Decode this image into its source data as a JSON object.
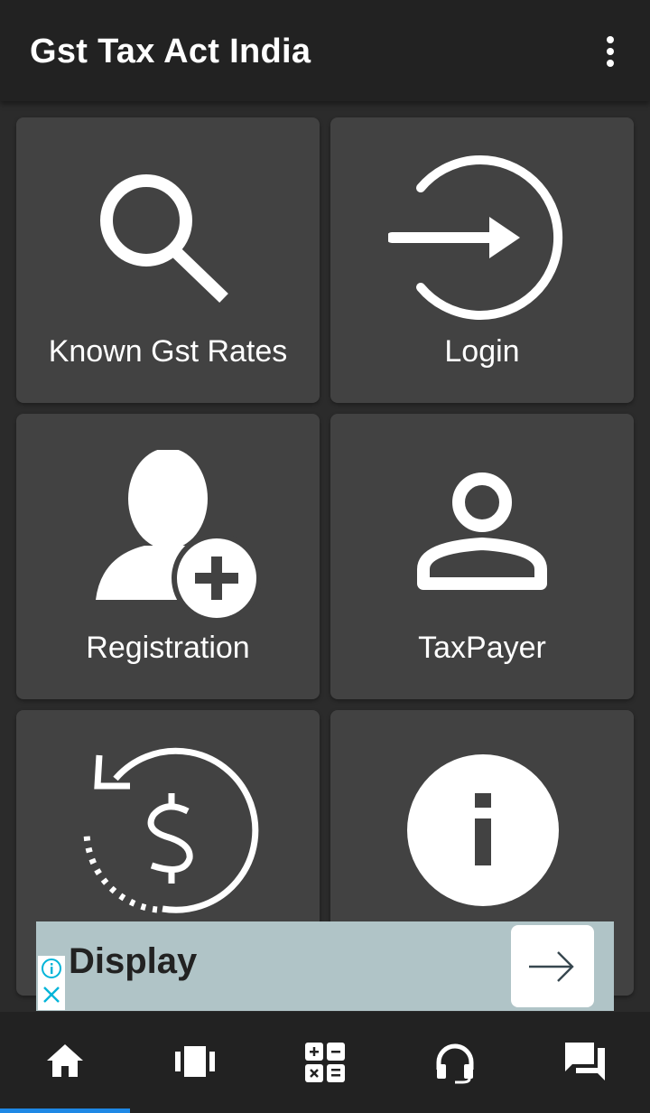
{
  "appbar": {
    "title": "Gst Tax Act India",
    "more_icon": "more-vert-icon"
  },
  "tiles": [
    {
      "label": "Known Gst Rates",
      "icon": "search-icon"
    },
    {
      "label": "Login",
      "icon": "login-icon"
    },
    {
      "label": "Registration",
      "icon": "add-user-icon"
    },
    {
      "label": "TaxPayer",
      "icon": "person-icon"
    },
    {
      "label": "",
      "icon": "refund-dollar-icon"
    },
    {
      "label": "",
      "icon": "info-icon"
    }
  ],
  "ad": {
    "headline": "Display",
    "cta_icon": "arrow-right-icon",
    "info_icon": "info-icon",
    "close_icon": "close-icon"
  },
  "bottom_nav": {
    "items": [
      {
        "name": "home",
        "icon": "home-icon",
        "active": true
      },
      {
        "name": "carousel",
        "icon": "carousel-icon",
        "active": false
      },
      {
        "name": "calculator",
        "icon": "calculator-icon",
        "active": false
      },
      {
        "name": "support",
        "icon": "headset-icon",
        "active": false
      },
      {
        "name": "chat",
        "icon": "chat-icon",
        "active": false
      }
    ]
  },
  "colors": {
    "background": "#2b2b2b",
    "bar": "#222222",
    "tile": "#424242",
    "active": "#1e88e5",
    "ad_bg": "#b0c4c7",
    "ad_accent": "#00b4d8"
  }
}
